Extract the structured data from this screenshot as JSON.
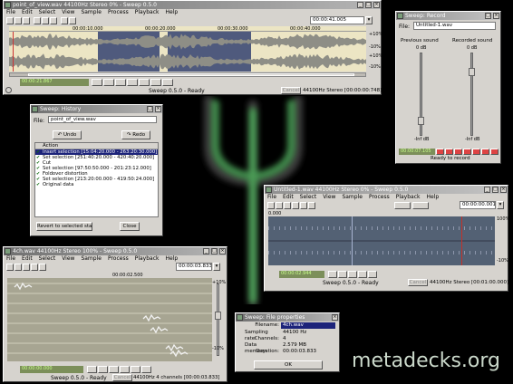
{
  "w1": {
    "title": "point_of_view.wav 44100Hz Stereo 0% - Sweep 0.5.0",
    "menu": [
      "File",
      "Edit",
      "Select",
      "View",
      "Sample",
      "Process",
      "Playback",
      "Help"
    ],
    "time": "00:00:41.005",
    "ruler": [
      "00:00:10.000",
      "00:00:20.000",
      "00:00:30.000",
      "00:00:40.000"
    ],
    "ticks": [
      "+10%",
      "-10%",
      "+10%",
      "-10%"
    ],
    "cursor": "00:00:21.867",
    "status": "Sweep 0.5.0 - Ready",
    "cancel": "Cancel",
    "info": "44100Hz Stereo [00:00:00:748]"
  },
  "w2": {
    "title": "Sweep: Record",
    "file_label": "File:",
    "file": "Untitled-1.wav",
    "prev": "Previous sound",
    "rec": "Recorded sound",
    "db0a": "0 dB",
    "db0b": "0 dB",
    "infa": "-Inf dB",
    "infb": "-Inf dB",
    "time": "00:00:07.105",
    "status": "Ready to record"
  },
  "w3": {
    "title": "Sweep: History",
    "file_label": "File:",
    "file": "point_of_view.wav",
    "undo": "Undo",
    "redo": "Redo",
    "header": "Action",
    "items": [
      "Insert selection [15:04:20.000 - 263:20:30.000]",
      "Set selection [251:40:20.000 - 420:40:20.000]",
      "Cut",
      "Set selection [97:50:50.000 - 201:23:12.000]",
      "Foldover distortion",
      "Set selection [213:20:00.000 - 419:50:24.000]",
      "Original data"
    ],
    "revert": "Revert to selected state",
    "close": "Close"
  },
  "w4": {
    "title": "Untitled-1.wav 44100Hz Stereo 0% - Sweep 0.5.0",
    "menu": [
      "File",
      "Edit",
      "Select",
      "View",
      "Sample",
      "Process",
      "Playback",
      "Help"
    ],
    "time": "00:00:00.001",
    "ruler": "0.000",
    "ticks": [
      "100%",
      "-10%"
    ],
    "cursor": "00:00:02.944",
    "status": "Sweep 0.5.0 - Ready",
    "cancel": "Cancel",
    "info": "44100Hz Stereo [00:01:00.000]"
  },
  "w5": {
    "title": "4ch.wav 44100Hz Stereo 100% - Sweep 0.5.0",
    "menu": [
      "File",
      "Edit",
      "Select",
      "View",
      "Sample",
      "Process",
      "Playback",
      "Help"
    ],
    "time": "00:00:03.833",
    "ruler": "00:00:02.500",
    "ticks": [
      "+10%",
      "-10%"
    ],
    "cursor": "00:00:00.000",
    "status": "Sweep 0.5.0 - Ready",
    "cancel": "Cancel",
    "info": "44100Hz 4 channels [00:00:03.833]"
  },
  "w6": {
    "title": "Sweep: File properties",
    "filename_label": "Filename:",
    "filename": "4ch.wav",
    "rows": [
      {
        "k": "Sampling rate:",
        "v": "44100 Hz"
      },
      {
        "k": "Channels:",
        "v": "4"
      },
      {
        "k": "Data memory:",
        "v": "2.579 MB"
      },
      {
        "k": "Duration:",
        "v": "00:00:03.833"
      }
    ],
    "ok": "OK"
  },
  "logo": "metadecks.org"
}
